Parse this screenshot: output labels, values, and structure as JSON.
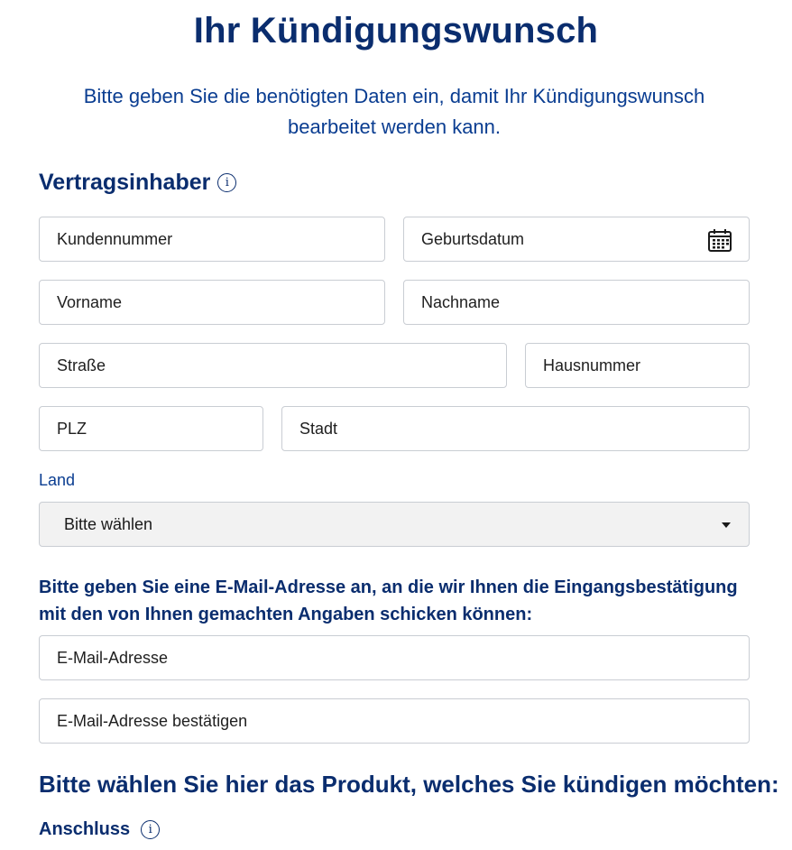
{
  "page": {
    "title": "Ihr Kündigungswunsch",
    "intro": "Bitte geben Sie die benötigten Daten ein, damit Ihr Kündigungswunsch bearbeitet werden kann."
  },
  "vertragsinhaber": {
    "heading": "Vertragsinhaber",
    "info_icon": "i",
    "fields": {
      "kundennummer": "Kundennummer",
      "geburtsdatum": "Geburtsdatum",
      "vorname": "Vorname",
      "nachname": "Nachname",
      "strasse": "Straße",
      "hausnummer": "Hausnummer",
      "plz": "PLZ",
      "stadt": "Stadt"
    },
    "land": {
      "label": "Land",
      "selected": "Bitte wählen"
    }
  },
  "email": {
    "note": "Bitte geben Sie eine E-Mail-Adresse an, an die wir Ihnen die Eingangsbestätigung mit den von Ihnen gemachten Angaben schicken können:",
    "address_placeholder": "E-Mail-Adresse",
    "confirm_placeholder": "E-Mail-Adresse bestätigen"
  },
  "produkt": {
    "heading": "Bitte wählen Sie hier das Produkt, welches Sie kündigen möchten:",
    "anschluss_label": "Anschluss",
    "info_icon": "i"
  },
  "icons": {
    "info": "info-circle-icon",
    "calendar": "calendar-icon",
    "dropdown": "chevron-down-icon"
  },
  "colors": {
    "brand_dark": "#0a2d6e",
    "brand_text": "#0a3d91",
    "field_border": "#c9cdd3",
    "select_bg": "#f2f2f2"
  }
}
